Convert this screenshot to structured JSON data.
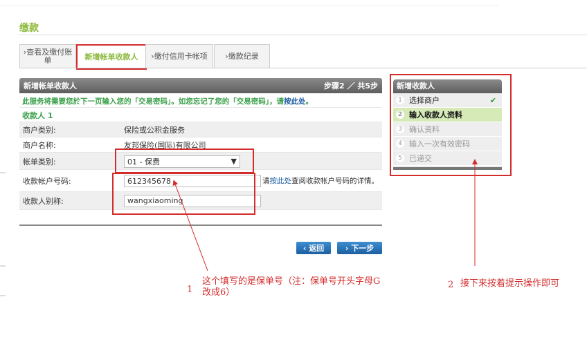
{
  "page": {
    "title": "缴款"
  },
  "tabs": [
    {
      "label": "›查看及缴付账单"
    },
    {
      "label": "新增帐单收款人"
    },
    {
      "label": "›缴付信用卡帐项"
    },
    {
      "label": "›缴款纪录"
    }
  ],
  "panel": {
    "title": "新增帐单收款人",
    "step": "步骤2 ／ 共5步",
    "notice": "此服务将需要您於下一页输入您的「交易密码」。如您忘记了您的「交易密码」，请",
    "notice_link": "按此处",
    "notice_end": "。",
    "payee_heading": "收款人 1",
    "rows": [
      {
        "label": "商户类别:",
        "value": "保险或公积金服务"
      },
      {
        "label": "商户名称:",
        "value": "友邦保险(国际)有限公司"
      },
      {
        "label": "帐单类别:",
        "value": "01 - 保费"
      },
      {
        "label": "收款帐户号码:",
        "value": "612345678"
      },
      {
        "label": "收款人别称:",
        "value": "wangxiaoming"
      }
    ],
    "hint_pre": "请",
    "hint_link": "按此处",
    "hint_post": "查阅收款帐户号码的详情。",
    "back": "返回",
    "next": "下一步"
  },
  "steps": {
    "title": "新增收款人",
    "items": [
      {
        "num": "1",
        "label": "选择商户"
      },
      {
        "num": "2",
        "label": "输入收款人资料"
      },
      {
        "num": "3",
        "label": "确认资料"
      },
      {
        "num": "4",
        "label": "输入一次有效密码"
      },
      {
        "num": "5",
        "label": "已递交"
      }
    ]
  },
  "annotations": [
    {
      "num": "1",
      "text": "这个填写的是保单号（注：保单号开头字母G改成6）"
    },
    {
      "num": "2",
      "text": "接下来按着提示操作即可"
    }
  ]
}
